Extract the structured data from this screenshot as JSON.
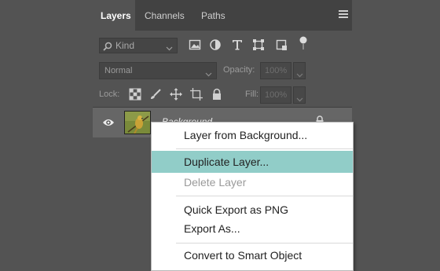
{
  "colors": {
    "panel_bg": "#535353",
    "tab_bar_bg": "#424242",
    "layer_row_bg": "#666666",
    "menu_highlight": "#91cdc8",
    "menu_disabled_text": "#9a9a9a"
  },
  "panel": {
    "tabs": [
      {
        "label": "Layers",
        "active": true
      },
      {
        "label": "Channels",
        "active": false
      },
      {
        "label": "Paths",
        "active": false
      }
    ],
    "menu_icon": "hamburger-icon"
  },
  "filter": {
    "kind_label": "Kind",
    "icons": [
      "image-filter-icon",
      "adjustment-filter-icon",
      "type-filter-icon",
      "shape-filter-icon",
      "smart-object-filter-icon",
      "filter-toggle-icon"
    ]
  },
  "blend": {
    "mode": "Normal",
    "opacity_label": "Opacity:",
    "opacity_value": "100%"
  },
  "lock": {
    "label": "Lock:",
    "icons": [
      "lock-transparent-pixels-icon",
      "lock-image-pixels-icon",
      "lock-position-icon",
      "lock-artboard-icon",
      "lock-all-icon"
    ],
    "fill_label": "Fill:",
    "fill_value": "100%"
  },
  "layer": {
    "name": "Background",
    "visible": true
  },
  "context_menu": {
    "items": [
      {
        "label": "Layer from Background...",
        "state": "normal"
      },
      {
        "label": "Duplicate Layer...",
        "state": "highlighted"
      },
      {
        "label": "Delete Layer",
        "state": "disabled"
      },
      {
        "label": "Quick Export as PNG",
        "state": "normal"
      },
      {
        "label": "Export As...",
        "state": "normal"
      },
      {
        "label": "Convert to Smart Object",
        "state": "normal"
      }
    ]
  }
}
